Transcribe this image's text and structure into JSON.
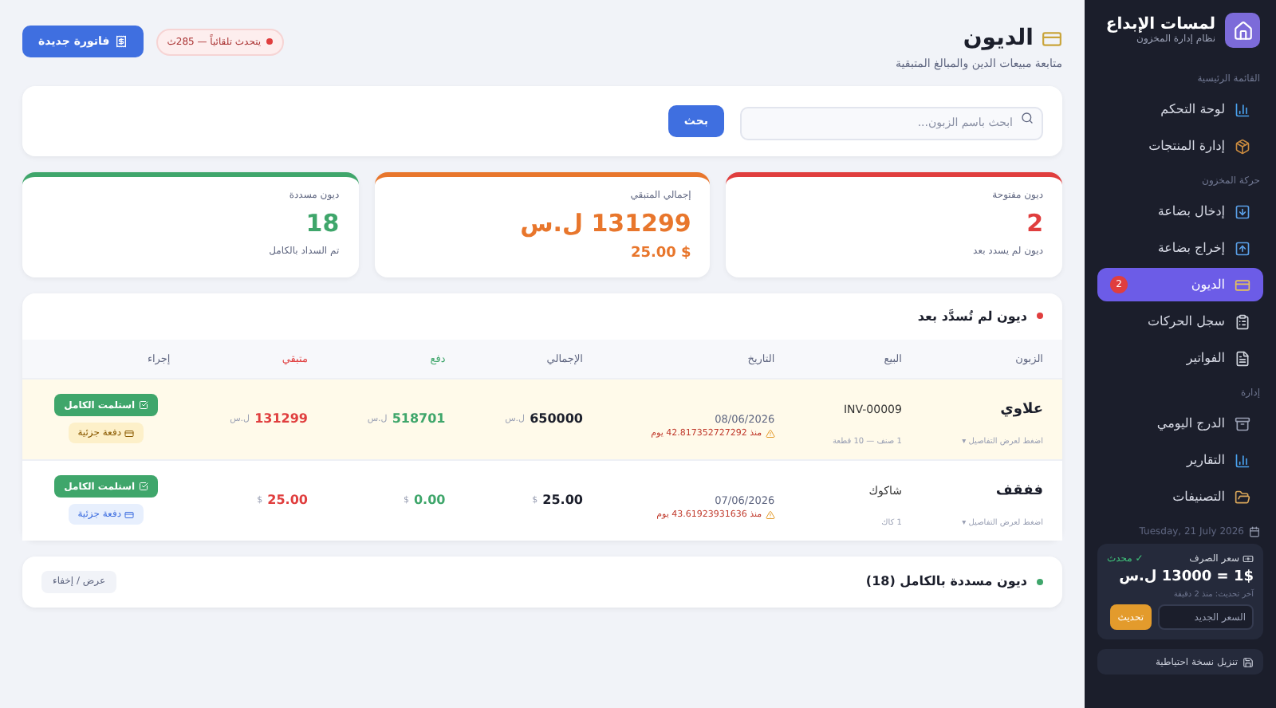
{
  "sidebar": {
    "brand": {
      "title": "لمسات الإبداع",
      "subtitle": "نظام إدارة المخزون"
    },
    "sections": [
      {
        "heading": "القائمة الرئيسية",
        "items": [
          {
            "label": "لوحة التحكم",
            "selected": false
          },
          {
            "label": "إدارة المنتجات",
            "selected": false
          }
        ]
      },
      {
        "heading": "حركة المخزون",
        "items": [
          {
            "label": "إدخال بضاعة",
            "selected": false
          },
          {
            "label": "إخراج بضاعة",
            "selected": false
          },
          {
            "label": "الديون",
            "selected": true,
            "badge": "2"
          },
          {
            "label": "سجل الحركات",
            "selected": false
          },
          {
            "label": "الفواتير",
            "selected": false
          }
        ]
      },
      {
        "heading": "إدارة",
        "items": [
          {
            "label": "الدرج اليومي",
            "selected": false
          },
          {
            "label": "التقارير",
            "selected": false
          },
          {
            "label": "التصنيفات",
            "selected": false
          }
        ]
      }
    ],
    "date": "Tuesday, 21 July 2026",
    "rate": {
      "title": "سعر الصرف",
      "status": "✓ محدث",
      "value": "1$ = 13000 ل.س",
      "updated": "آخر تحديث: منذ 2 دقيقة",
      "placeholder": "السعر الجديد",
      "button": "تحديث"
    },
    "backup": "تنزيل نسخة احتياطية"
  },
  "header": {
    "title": "الديون",
    "subtitle": "متابعة مبيعات الدين والمبالغ المتبقية",
    "auto_refresh": "يتحدث تلقائياً — 285ث",
    "new_button": "فاتورة جديدة"
  },
  "search": {
    "placeholder": "ابحث باسم الزبون...",
    "button": "بحث"
  },
  "stats": [
    {
      "label": "ديون مفتوحة",
      "value": "2",
      "note": "ديون لم يسدد بعد",
      "color": "#e03e3e"
    },
    {
      "label": "إجمالي المتبقي",
      "value": "131299 ل.س",
      "note": "$ 25.00",
      "color": "#e8762c"
    },
    {
      "label": "ديون مسددة",
      "value": "18",
      "note": "تم السداد بالكامل",
      "color": "#3fa66b"
    }
  ],
  "open_debts": {
    "title": "ديون لم تُسدَّد بعد",
    "columns": [
      "الزبون",
      "البيع",
      "التاريخ",
      "الإجمالي",
      "دفع",
      "متبقي",
      "إجراء"
    ],
    "rows": [
      {
        "customer": "علاوي",
        "hint": "اضغط لعرض التفاصيل ▾",
        "sale": "INV-00009",
        "sale_note": "1 صنف — 10 قطعة",
        "date": "08/06/2026",
        "age": "منذ 42.817352727292 يوم",
        "total": "650000",
        "total_unit": "ل.س",
        "paid": "518701",
        "paid_unit": "ل.س",
        "remaining": "131299",
        "remaining_unit": "ل.س",
        "highlighted": true,
        "full_button": "استلمت الكامل",
        "partial_button": "دفعة جزئية"
      },
      {
        "customer": "ففقف",
        "hint": "اضغط لعرض التفاصيل ▾",
        "sale": "شاكوك",
        "sale_note": "1 كاك",
        "date": "07/06/2026",
        "age": "منذ 43.61923931636 يوم",
        "total": "25.00",
        "total_unit": "$",
        "paid": "0.00",
        "paid_unit": "$",
        "remaining": "25.00",
        "remaining_unit": "$",
        "highlighted": false,
        "full_button": "استلمت الكامل",
        "partial_button": "دفعة جزئية"
      }
    ]
  },
  "paid_debts": {
    "title": "ديون مسددة بالكامل (18)",
    "toggle": "عرض / إخفاء"
  }
}
